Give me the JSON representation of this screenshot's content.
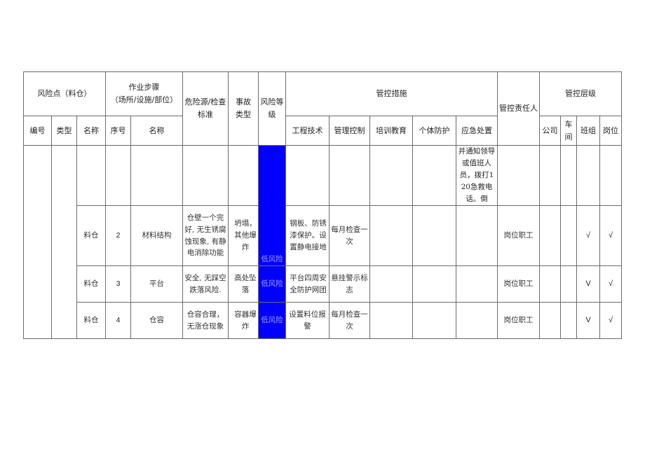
{
  "header": {
    "risk_point": "风险点（料仓）",
    "work_step_line1": "作业步骤",
    "work_step_line2": "（场所/设施/部位）",
    "hazard_standard": "危险源/检查标准",
    "accident_type": "事故类型",
    "risk_level": "风险等级",
    "control_measures": "管控措施",
    "responsible": "管控责任人",
    "control_level": "管控层级",
    "sub": {
      "code": "编号",
      "type": "类型",
      "name": "名称",
      "seq": "序号",
      "step_name": "名称",
      "engineering": "工程技术",
      "management": "管理控制",
      "training": "培训教育",
      "ppe": "个体防护",
      "emergency": "应急处置",
      "company": "公司",
      "workshop": "车间",
      "team": "班组",
      "post": "岗位"
    }
  },
  "rows": [
    {
      "code": "",
      "type": "",
      "name": "",
      "seq": "",
      "step_name": "",
      "hazard": "",
      "accident": "",
      "risk": "",
      "engineering": "",
      "management": "",
      "training": "",
      "ppe": "",
      "emergency": "并通知领导或值班人员，拨打120急救电话。倒",
      "responsible": "",
      "company": "",
      "workshop": "",
      "team": "",
      "post": ""
    },
    {
      "code": "",
      "type": "",
      "name": "料仓",
      "seq": "2",
      "step_name": "材料结构",
      "hazard": "仓壁一个完好, 无生锈腐蚀现象, 有静电消除功能",
      "accident": "坍塌，其他爆炸",
      "risk": "低风险",
      "engineering": "钢板、防锈漆保护。设置静电接地",
      "management": "每月检查一次",
      "training": "",
      "ppe": "",
      "emergency": "",
      "responsible": "岗位职工",
      "company": "",
      "workshop": "",
      "team": "√",
      "post": "√"
    },
    {
      "code": "",
      "type": "",
      "name": "料仓",
      "seq": "3",
      "step_name": "平台",
      "hazard": "安全, 无踩空跌落风险.",
      "accident": "高处坠落",
      "risk": "低风险",
      "engineering": "平台四周安全防护网团",
      "management": "悬挂警示标志",
      "training": "",
      "ppe": "",
      "emergency": "",
      "responsible": "岗位职工",
      "company": "",
      "workshop": "",
      "team": "V",
      "post": "√"
    },
    {
      "code": "",
      "type": "",
      "name": "料仓",
      "seq": "4",
      "step_name": "仓容",
      "hazard": "仓容合理，无涨仓现象",
      "accident": "容器爆炸",
      "risk": "低风险",
      "engineering": "设置料位报警",
      "management": "每月检查一次",
      "training": "",
      "ppe": "",
      "emergency": "",
      "responsible": "岗位职工",
      "company": "",
      "workshop": "",
      "team": "V",
      "post": "√"
    }
  ],
  "colors": {
    "risk_low": "#0000ff",
    "risk_low_text": "#9d9dff",
    "border": "#6b6b6b"
  }
}
